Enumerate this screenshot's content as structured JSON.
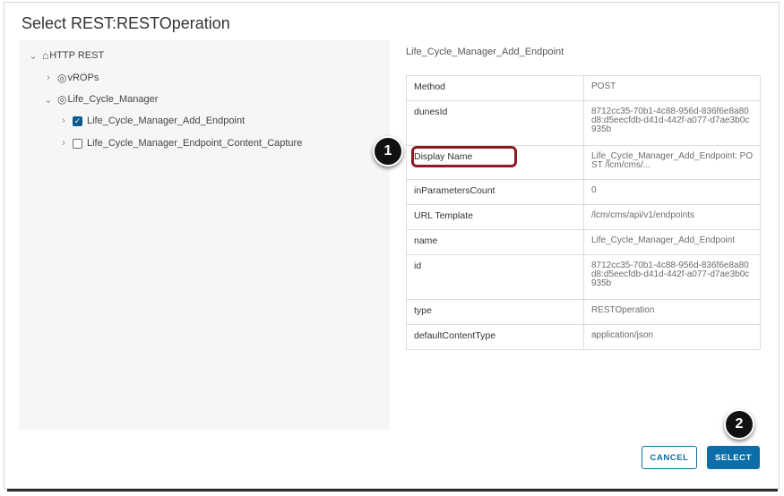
{
  "dialog": {
    "title": "Select REST:RESTOperation"
  },
  "tree": {
    "root": {
      "label": "HTTP REST",
      "icon": "⌂"
    },
    "child1": {
      "label": "vROPs",
      "icon": "◎"
    },
    "child2": {
      "label": "Life_Cycle_Manager",
      "icon": "◎"
    },
    "leaf1": {
      "label": "Life_Cycle_Manager_Add_Endpoint",
      "checked": true
    },
    "leaf2": {
      "label": "Life_Cycle_Manager_Endpoint_Content_Capture",
      "checked": false
    }
  },
  "details": {
    "title": "Life_Cycle_Manager_Add_Endpoint",
    "rows": [
      {
        "key": "Method",
        "value": "POST"
      },
      {
        "key": "dunesId",
        "value": "8712cc35-70b1-4c88-956d-836f6e8a80d8:d5eecfdb-d41d-442f-a077-d7ae3b0c935b"
      },
      {
        "key": "Display Name",
        "value": "Life_Cycle_Manager_Add_Endpoint: POST /lcm/cms/..."
      },
      {
        "key": "inParametersCount",
        "value": "0"
      },
      {
        "key": "URL Template",
        "value": "/lcm/cms/api/v1/endpoints"
      },
      {
        "key": "name",
        "value": "Life_Cycle_Manager_Add_Endpoint"
      },
      {
        "key": "id",
        "value": "8712cc35-70b1-4c88-956d-836f6e8a80d8:d5eecfdb-d41d-442f-a077-d7ae3b0c935b"
      },
      {
        "key": "type",
        "value": "RESTOperation"
      },
      {
        "key": "defaultContentType",
        "value": "application/json"
      }
    ]
  },
  "markers": {
    "m1": "1",
    "m2": "2"
  },
  "buttons": {
    "cancel": "CANCEL",
    "select": "SELECT"
  },
  "colors": {
    "accent": "#0b6ea8",
    "highlight": "#8b1c24",
    "checkbox": "#0b5b8f"
  }
}
